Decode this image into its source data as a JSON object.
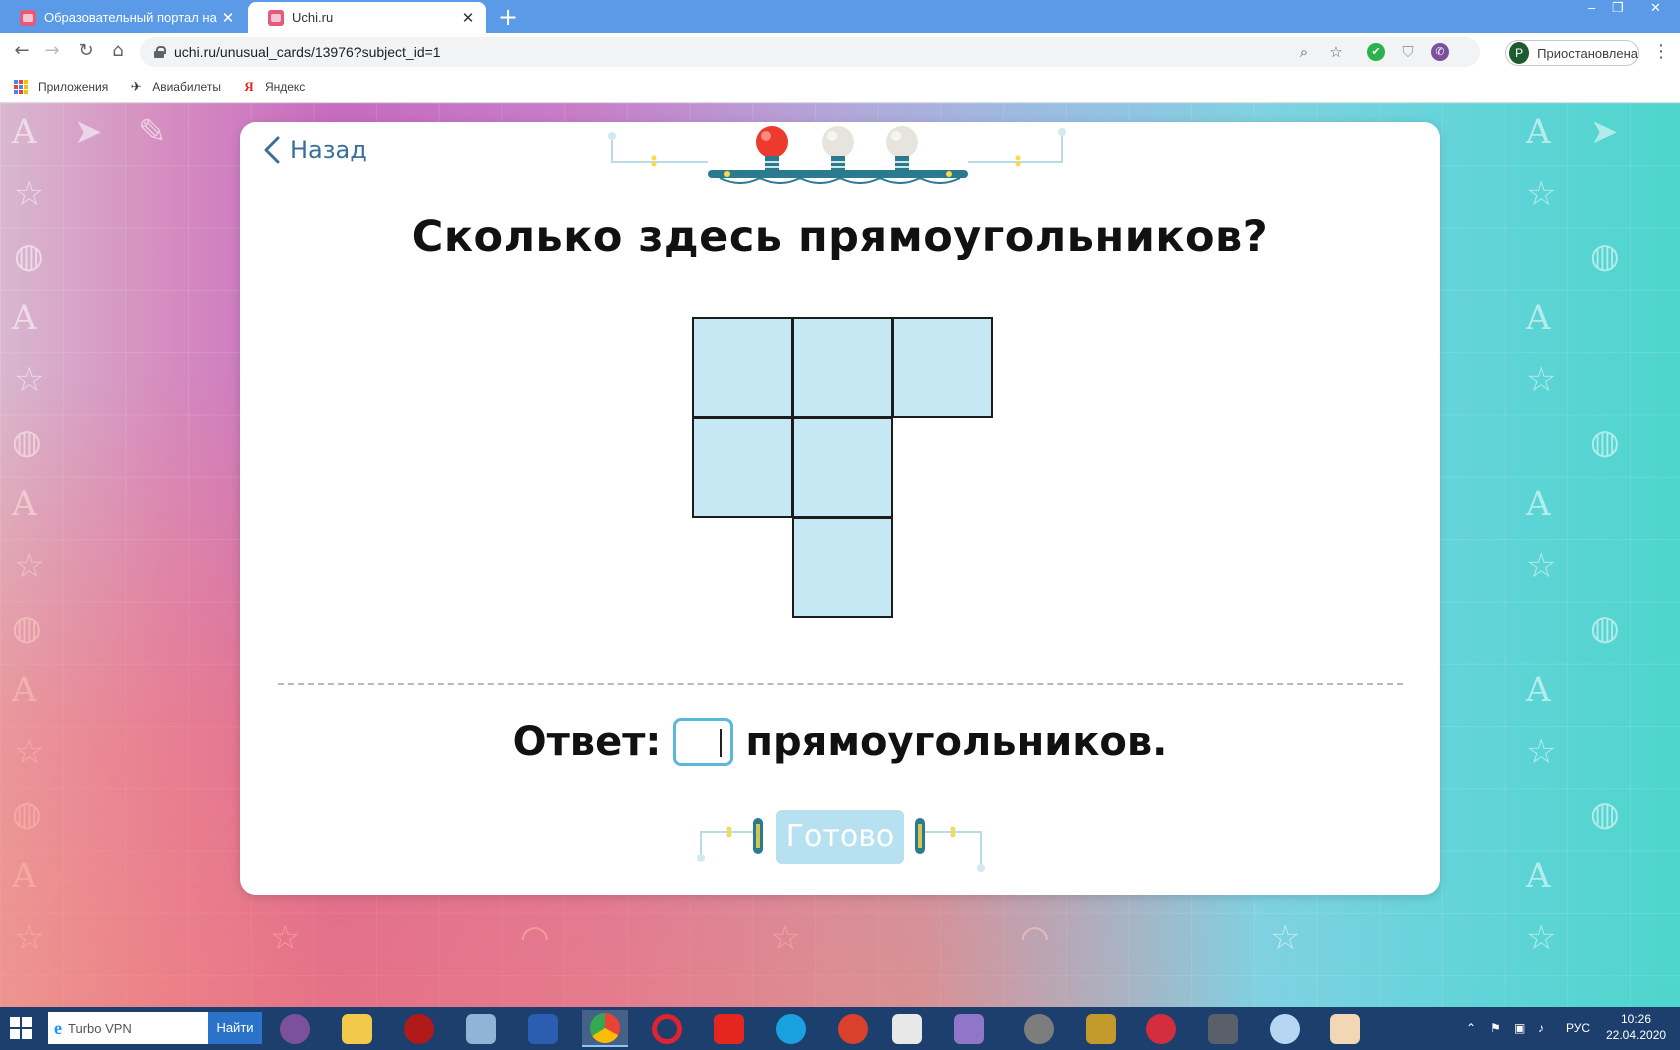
{
  "browser": {
    "tabs": [
      {
        "title": "Образовательный портал на ба",
        "active": false
      },
      {
        "title": "Uchi.ru",
        "active": true
      }
    ],
    "new_tab": "+",
    "url": "uchi.ru/unusual_cards/13976?subject_id=1",
    "profile": {
      "initial": "P",
      "status": "Приостановлена"
    },
    "bookmarks": [
      {
        "label": "Приложения",
        "icon": "apps-grid-icon"
      },
      {
        "label": "Авиабилеты",
        "icon": "airplane-icon"
      },
      {
        "label": "Яндекс",
        "icon": "yandex-icon"
      }
    ]
  },
  "card": {
    "back_label": "Назад",
    "question": "Сколько здесь прямоугольников?",
    "figure": {
      "cells": [
        [
          0,
          0
        ],
        [
          1,
          0
        ],
        [
          2,
          0
        ],
        [
          0,
          1
        ],
        [
          1,
          1
        ],
        [
          1,
          2
        ]
      ],
      "fill": "#c5e8f4",
      "stroke": "#1c1c1c"
    },
    "answer_prefix": "Ответ:",
    "answer_value": "",
    "answer_suffix": "прямоугольников.",
    "submit_label": "Готово",
    "progress_bulbs": {
      "total": 3,
      "lit": 1
    }
  },
  "taskbar": {
    "search_placeholder": "Turbo VPN",
    "search_button": "Найти",
    "language": "РУС",
    "time": "10:26",
    "date": "22.04.2020"
  },
  "colors": {
    "accent": "#5cb8d8",
    "back_link": "#3a6f9a",
    "button_disabled": "#b7e1f0",
    "tabstrip": "#5a9ae6",
    "taskbar": "#1d3f6e"
  }
}
